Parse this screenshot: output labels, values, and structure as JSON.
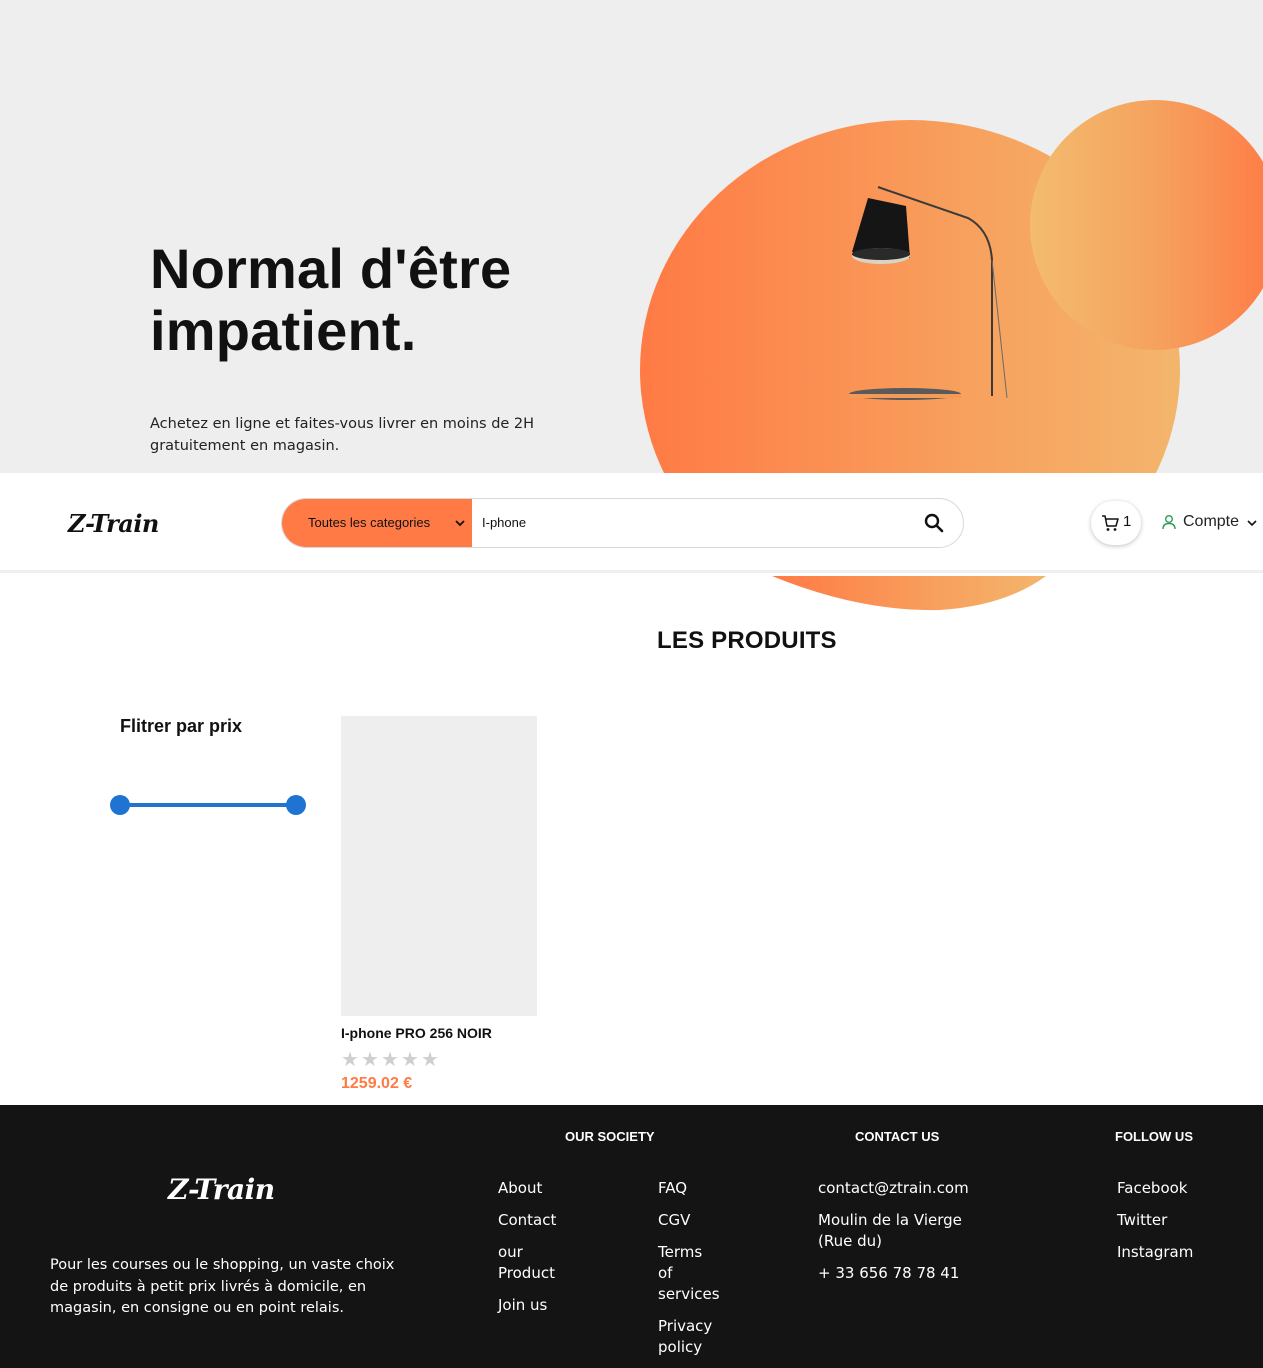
{
  "hero": {
    "title_line1": "Normal d'être",
    "title_line2": "impatient.",
    "subtitle_line1": "Achetez en ligne et faites-vous livrer en moins de 2H",
    "subtitle_line2": "gratuitement en magasin."
  },
  "navbar": {
    "logo": "Z-Train",
    "category_select": "Toutes les categories",
    "search_value": "I-phone",
    "cart_count": "1",
    "account_label": "Compte"
  },
  "products": {
    "section_title": "LES PRODUITS",
    "filter_title": "Flitrer par prix",
    "items": [
      {
        "name": "I-phone PRO 256 NOIR",
        "price": "1259.02 €",
        "rating": 0,
        "max_rating": 5
      }
    ]
  },
  "footer": {
    "logo": "Z-Train",
    "description": "Pour les courses ou le shopping, un vaste choix de produits à petit prix livrés à domicile, en magasin, en consigne ou en point relais.",
    "our_society": {
      "heading": "OUR SOCIETY",
      "col1": [
        "About",
        "Contact",
        "our Product",
        "Join us"
      ],
      "col2": [
        "FAQ",
        "CGV",
        "Terms of services",
        "Privacy policy"
      ]
    },
    "contact": {
      "heading": "CONTACT US",
      "email": "contact@ztrain.com",
      "address": "Moulin de la Vierge (Rue du)",
      "phone": "+ 33 656 78 78 41"
    },
    "follow": {
      "heading": "FOLLOW US",
      "links": [
        "Facebook",
        "Twitter",
        "Instagram"
      ]
    }
  },
  "colors": {
    "accent": "#ff7a45",
    "slider": "#1f74d1",
    "footer_bg": "#141414",
    "hero_bg": "#eeeeee"
  }
}
